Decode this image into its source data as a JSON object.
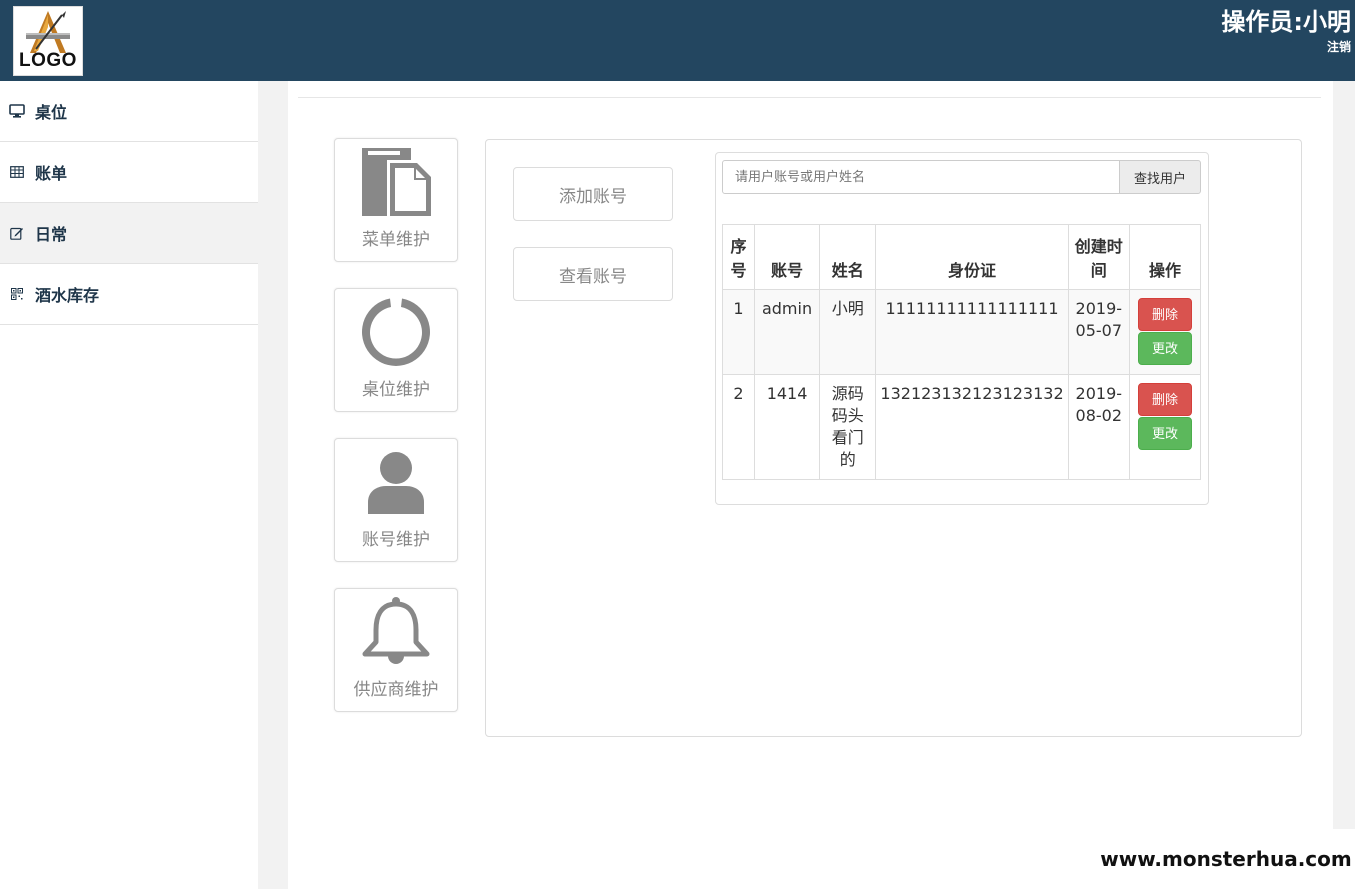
{
  "header": {
    "logo_text": "LOGO",
    "operator": "操作员:小明",
    "logout_label": "注销"
  },
  "sidebar": {
    "items": [
      {
        "label": "桌位",
        "icon": "monitor-icon"
      },
      {
        "label": "账单",
        "icon": "table-icon"
      },
      {
        "label": "日常",
        "icon": "edit-icon"
      },
      {
        "label": "酒水库存",
        "icon": "qrcode-icon"
      }
    ],
    "active_index": 2
  },
  "tiles": [
    {
      "label": "菜单维护",
      "icon": "file-icon"
    },
    {
      "label": "桌位维护",
      "icon": "circle-notch-icon"
    },
    {
      "label": "账号维护",
      "icon": "user-icon"
    },
    {
      "label": "供应商维护",
      "icon": "bell-icon"
    }
  ],
  "actions": {
    "add_account": "添加账号",
    "view_account": "查看账号"
  },
  "search": {
    "placeholder": "请用户账号或用户姓名",
    "button_label": "查找用户"
  },
  "table": {
    "headers": [
      "序号",
      "账号",
      "姓名",
      "身份证",
      "创建时间",
      "操作"
    ],
    "rows": [
      {
        "index": "1",
        "account": "admin",
        "name": "小明",
        "id_card": "11111111111111111",
        "created": "2019-05-07"
      },
      {
        "index": "2",
        "account": "1414",
        "name": "源码码头看门的",
        "id_card": "132123132123123132",
        "created": "2019-08-02"
      }
    ],
    "delete_label": "删除",
    "edit_label": "更改"
  },
  "watermark": "www.monsterhua.com",
  "colors": {
    "header_bg": "#234660",
    "delete": "#d9534f",
    "edit": "#5cb85c",
    "icon_gray": "#888888"
  }
}
